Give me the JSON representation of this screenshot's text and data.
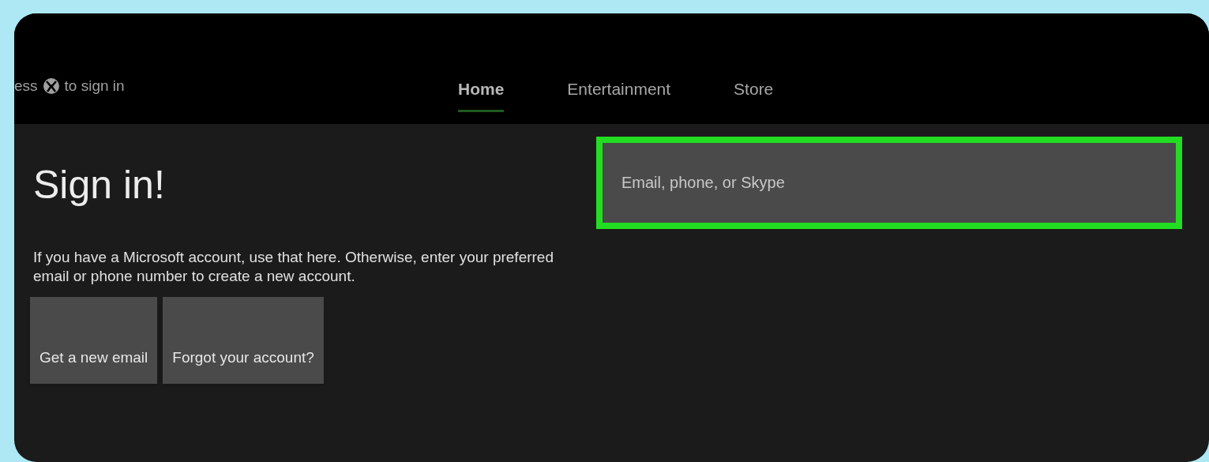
{
  "top_bar": {
    "prompt_before": "ess",
    "prompt_after": "to sign in"
  },
  "tabs": [
    {
      "label": "Home",
      "selected": true
    },
    {
      "label": "Entertainment",
      "selected": false
    },
    {
      "label": "Store",
      "selected": false
    }
  ],
  "heading": "Sign in!",
  "description": "If you have a Microsoft account, use that here. Otherwise, enter your preferred email or phone number to create a new account.",
  "buttons": [
    "Get a new email",
    "Forgot your account?"
  ],
  "email_field": {
    "placeholder": "Email, phone, or Skype",
    "focused": true
  }
}
